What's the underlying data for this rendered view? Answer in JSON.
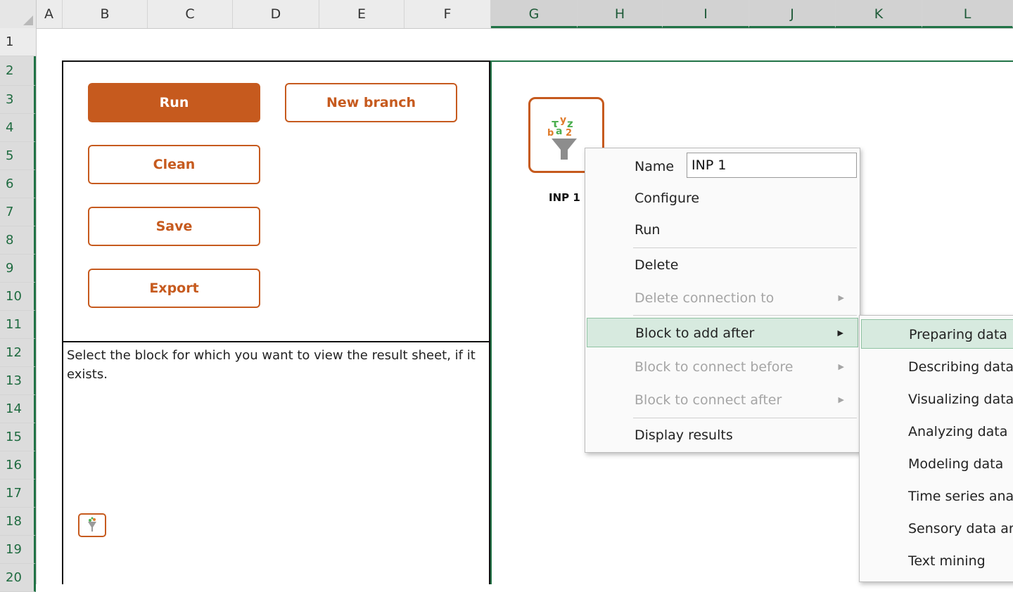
{
  "columns": [
    "A",
    "B",
    "C",
    "D",
    "E",
    "F",
    "G",
    "H",
    "I",
    "J",
    "K",
    "L"
  ],
  "rows": [
    "1",
    "2",
    "3",
    "4",
    "5",
    "6",
    "7",
    "8",
    "9",
    "10",
    "11",
    "12",
    "13",
    "14",
    "15",
    "16",
    "17",
    "18",
    "19",
    "20"
  ],
  "buttons": {
    "run": "Run",
    "new_branch": "New branch",
    "clean": "Clean",
    "save": "Save",
    "export": "Export"
  },
  "info_text": "Select the block for which you want to view the result sheet, if it exists.",
  "block": {
    "label": "INP 1",
    "icon": "funnel-letters-icon"
  },
  "context_menu": {
    "name_label": "Name",
    "name_value": "INP 1",
    "items": [
      {
        "label": "Configure"
      },
      {
        "label": "Run"
      },
      {
        "label": "Delete"
      },
      {
        "label": "Delete connection to"
      },
      {
        "label": "Block to add after"
      },
      {
        "label": "Block to connect before"
      },
      {
        "label": "Block to connect after"
      },
      {
        "label": "Display results"
      }
    ]
  },
  "submenu": {
    "items": [
      {
        "label": "Preparing data"
      },
      {
        "label": "Describing data"
      },
      {
        "label": "Visualizing data"
      },
      {
        "label": "Analyzing data"
      },
      {
        "label": "Modeling data"
      },
      {
        "label": "Time series analysis"
      },
      {
        "label": "Sensory data analysis"
      },
      {
        "label": "Text mining"
      }
    ]
  },
  "colors": {
    "accent": "#c65a1e",
    "excel_green": "#217346",
    "highlight": "#d7eadf"
  }
}
